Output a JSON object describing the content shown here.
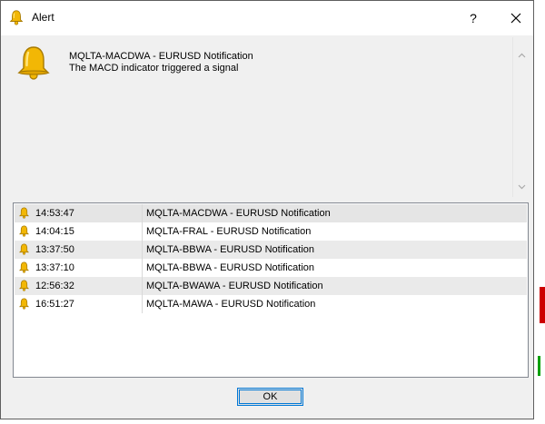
{
  "window": {
    "title": "Alert",
    "help_label": "?",
    "close_icon": "close-icon"
  },
  "message": {
    "icon": "bell-icon",
    "title": "MQLTA-MACDWA - EURUSD Notification",
    "body": "The MACD indicator triggered a signal"
  },
  "alerts": [
    {
      "time": "14:53:47",
      "text": "MQLTA-MACDWA - EURUSD Notification"
    },
    {
      "time": "14:04:15",
      "text": "MQLTA-FRAL - EURUSD Notification"
    },
    {
      "time": "13:37:50",
      "text": "MQLTA-BBWA - EURUSD Notification"
    },
    {
      "time": "13:37:10",
      "text": "MQLTA-BBWA - EURUSD Notification"
    },
    {
      "time": "12:56:32",
      "text": "MQLTA-BWAWA - EURUSD Notification"
    },
    {
      "time": "16:51:27",
      "text": "MQLTA-MAWA - EURUSD Notification"
    }
  ],
  "buttons": {
    "ok_label": "OK"
  },
  "colors": {
    "bell_gold": "#f2b705",
    "bell_highlight": "#ffe680",
    "accent": "#0078d7",
    "candle_red": "#cc0000",
    "candle_green": "#00a000"
  }
}
